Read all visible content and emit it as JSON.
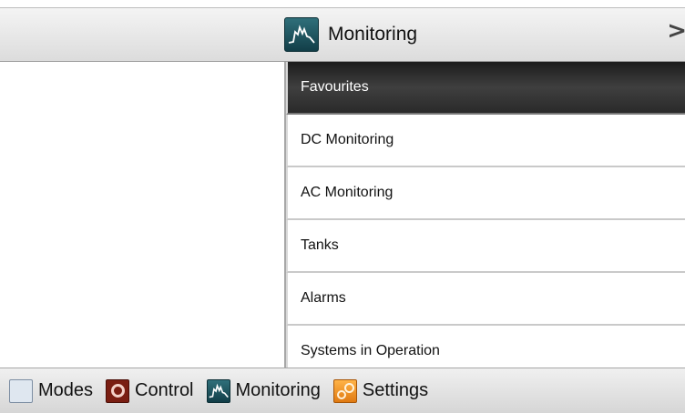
{
  "header": {
    "title": "Monitoring",
    "arrow": ">",
    "icon": "monitoring-icon"
  },
  "menu": {
    "items": [
      {
        "label": "Favourites",
        "selected": true
      },
      {
        "label": "DC Monitoring",
        "selected": false
      },
      {
        "label": "AC Monitoring",
        "selected": false
      },
      {
        "label": "Tanks",
        "selected": false
      },
      {
        "label": "Alarms",
        "selected": false
      },
      {
        "label": "Systems in Operation",
        "selected": false
      }
    ]
  },
  "bottom_bar": {
    "tabs": [
      {
        "label": "Modes",
        "icon": "modes-icon"
      },
      {
        "label": "Control",
        "icon": "control-icon"
      },
      {
        "label": "Monitoring",
        "icon": "monitoring-icon"
      },
      {
        "label": "Settings",
        "icon": "settings-icon"
      }
    ]
  },
  "colors": {
    "selected_bg": "#2a2a2a",
    "monitoring_teal": "#1f5a64",
    "control_red": "#7a1e12",
    "settings_orange": "#f0961f"
  }
}
